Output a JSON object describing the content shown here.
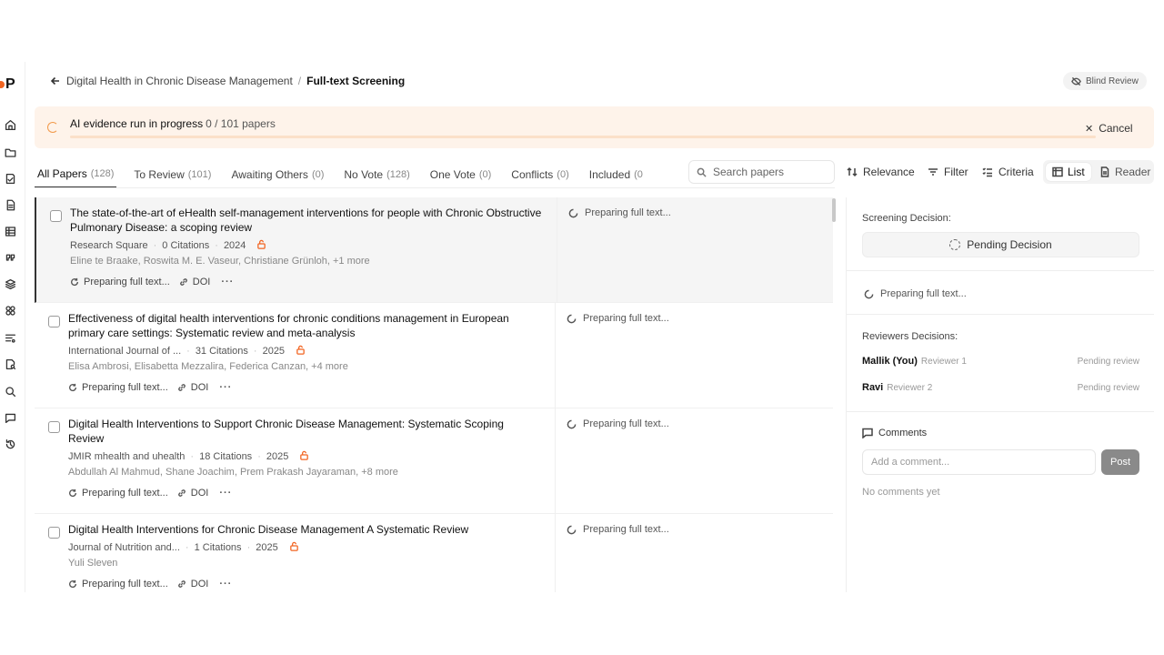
{
  "header": {
    "breadcrumb_parent": "Digital Health in Chronic Disease Management",
    "breadcrumb_sep": "/",
    "breadcrumb_current": "Full-text Screening",
    "blind_review_label": "Blind Review"
  },
  "banner": {
    "title": "AI evidence run in progress",
    "count": "0 / 101 papers",
    "progress": 0.0,
    "cancel_label": "Cancel"
  },
  "tabs": [
    {
      "label": "All Papers",
      "count": "(128)"
    },
    {
      "label": "To Review",
      "count": "(101)"
    },
    {
      "label": "Awaiting Others",
      "count": "(0)"
    },
    {
      "label": "No Vote",
      "count": "(128)"
    },
    {
      "label": "One Vote",
      "count": "(0)"
    },
    {
      "label": "Conflicts",
      "count": "(0)"
    },
    {
      "label": "Included",
      "count": "(0"
    }
  ],
  "toolbar": {
    "search_placeholder": "Search papers",
    "sort_label": "Relevance",
    "filter_label": "Filter",
    "criteria_label": "Criteria",
    "list_label": "List",
    "reader_label": "Reader"
  },
  "papers": [
    {
      "title": "The state-of-the-art of eHealth self-management interventions for people with Chronic Obstructive Pulmonary Disease: a scoping review",
      "venue": "Research Square",
      "citations": "0 Citations",
      "year": "2024",
      "authors": "Eline te Braake, Roswita M. E. Vaseur, Christiane Grünloh, +1 more",
      "status": "Preparing full text...",
      "doi": "DOI",
      "more": "···",
      "side_status": "Preparing full text..."
    },
    {
      "title": "Effectiveness of digital health interventions for chronic conditions management in European primary care settings: Systematic review and meta-analysis",
      "venue": "International Journal of ...",
      "citations": "31 Citations",
      "year": "2025",
      "authors": "Elisa Ambrosi, Elisabetta Mezzalira, Federica Canzan, +4 more",
      "status": "Preparing full text...",
      "doi": "DOI",
      "more": "···",
      "side_status": "Preparing full text..."
    },
    {
      "title": "Digital Health Interventions to Support Chronic Disease Management: Systematic Scoping Review",
      "venue": "JMIR mhealth and uhealth",
      "citations": "18 Citations",
      "year": "2025",
      "authors": "Abdullah Al Mahmud, Shane Joachim, Prem Prakash Jayaraman, +8 more",
      "status": "Preparing full text...",
      "doi": "DOI",
      "more": "···",
      "side_status": "Preparing full text..."
    },
    {
      "title": "Digital Health Interventions for Chronic Disease Management A Systematic Review",
      "venue": "Journal of Nutrition and...",
      "citations": "1 Citations",
      "year": "2025",
      "authors": "Yuli Sleven",
      "status": "Preparing full text...",
      "doi": "DOI",
      "more": "···",
      "side_status": "Preparing full text..."
    }
  ],
  "panel": {
    "decision_label": "Screening Decision:",
    "pending_label": "Pending Decision",
    "preparing_label": "Preparing full text...",
    "reviewers_label": "Reviewers Decisions:",
    "reviewers": [
      {
        "name": "Mallik (You)",
        "role": "Reviewer 1",
        "status": "Pending review"
      },
      {
        "name": "Ravi",
        "role": "Reviewer 2",
        "status": "Pending review"
      }
    ],
    "comments_label": "Comments",
    "comment_placeholder": "Add a comment...",
    "post_label": "Post",
    "no_comments": "No comments yet"
  },
  "colors": {
    "accent": "#f26522",
    "banner_bg": "#fef3ea",
    "progress_track": "#fbe0c9"
  }
}
